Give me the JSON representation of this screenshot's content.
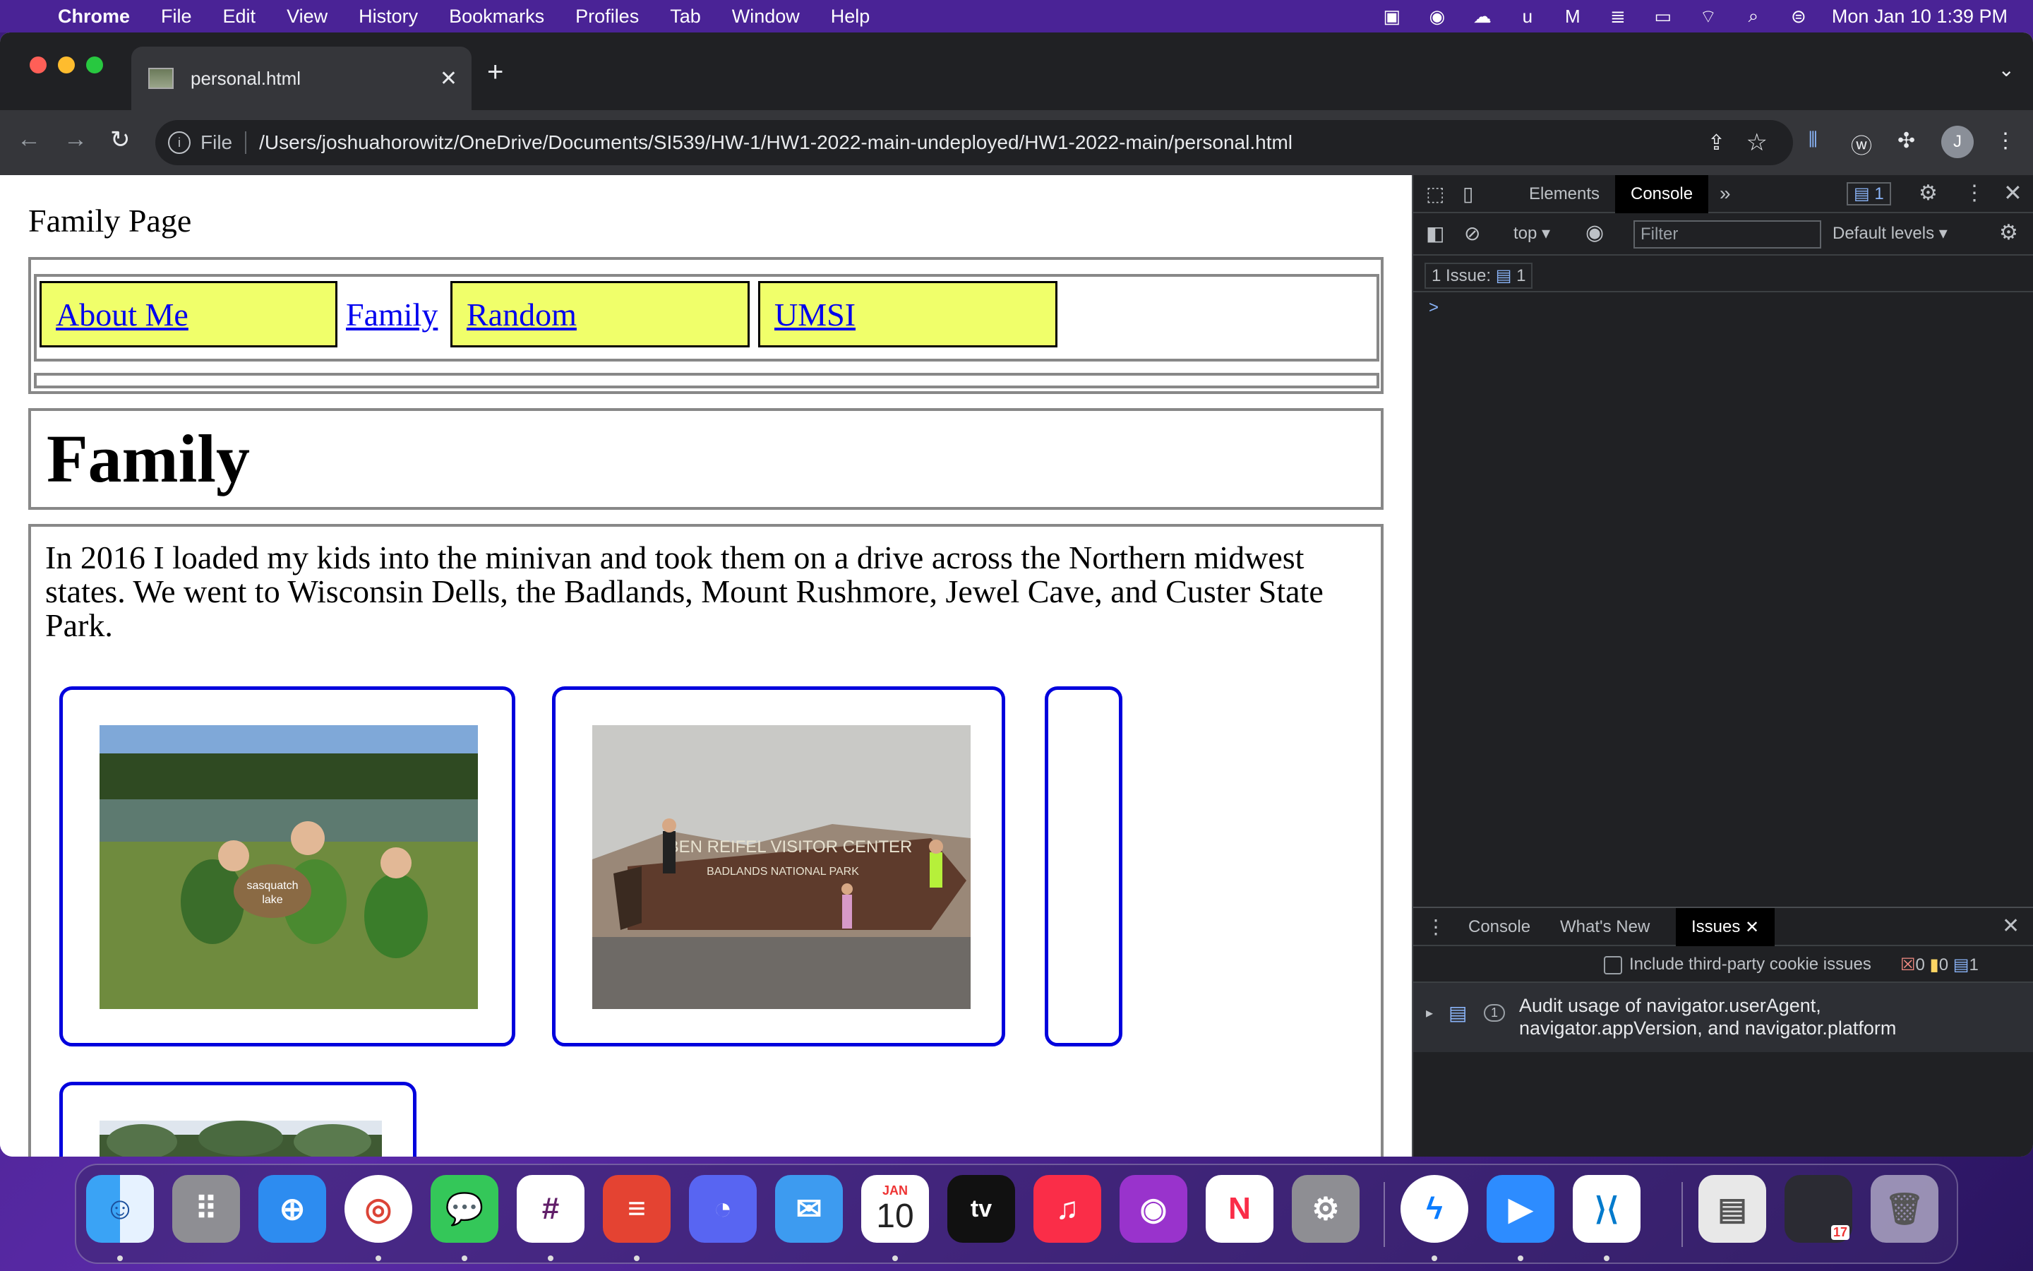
{
  "menubar": {
    "app": "Chrome",
    "items": [
      "File",
      "Edit",
      "View",
      "History",
      "Bookmarks",
      "Profiles",
      "Tab",
      "Window",
      "Help"
    ],
    "clock": "Mon Jan 10  1:39 PM"
  },
  "browser": {
    "tab_title": "personal.html",
    "new_tab": "+",
    "url_scheme": "File",
    "url": "/Users/joshuahorowitz/OneDrive/Documents/SI539/HW-1/HW1-2022-main-undeployed/HW1-2022-main/personal.html",
    "profile_initial": "J"
  },
  "page": {
    "site_title": "Family Page",
    "nav": [
      "About Me",
      "Family",
      "Random",
      "UMSI"
    ],
    "heading": "Family",
    "paragraph": "In 2016 I loaded my kids into the minivan and took them on a drive across the Northern midwest states. We went to Wisconsin Dells, the Badlands, Mount Rushmore, Jewel Cave, and Custer State Park.",
    "photo2_sign_line1": "BEN REIFEL VISITOR CENTER",
    "photo2_sign_line2": "BADLANDS NATIONAL PARK",
    "photo1_sign_line1": "sasquatch",
    "photo1_sign_line2": "lake"
  },
  "devtools": {
    "tabs": [
      "Elements",
      "Console"
    ],
    "active_tab": "Console",
    "issue_badge_count": "1",
    "context": "top",
    "filter_placeholder": "Filter",
    "levels": "Default levels",
    "issues_summary": "1 Issue:",
    "issues_summary_count": "1",
    "prompt": ">",
    "drawer_tabs": [
      "Console",
      "What's New",
      "Issues"
    ],
    "active_drawer_tab": "Issues",
    "third_party_label": "Include third-party cookie issues",
    "error_count": "0",
    "warning_count": "0",
    "info_count": "1",
    "issue_count_small": "1",
    "issue_text_line1": "Audit usage of navigator.userAgent,",
    "issue_text_line2": "navigator.appVersion, and navigator.platform"
  },
  "dock": {
    "calendar_month": "JAN",
    "calendar_day": "10",
    "preview_badge": "17",
    "apps": [
      "Finder",
      "Launchpad",
      "Safari",
      "Chrome",
      "Messages",
      "Slack",
      "Todoist",
      "Discord",
      "Mail",
      "Calendar",
      "TV",
      "Music",
      "Podcasts",
      "News",
      "System Preferences",
      "Messenger",
      "Zoom",
      "Visual Studio Code",
      "Preview",
      "Screenshot",
      "Trash"
    ]
  },
  "colors": {
    "nav_highlight": "#f0ff6a",
    "link": "#0000ee",
    "card_border": "#0000dd",
    "menubar": "#4a2396"
  }
}
